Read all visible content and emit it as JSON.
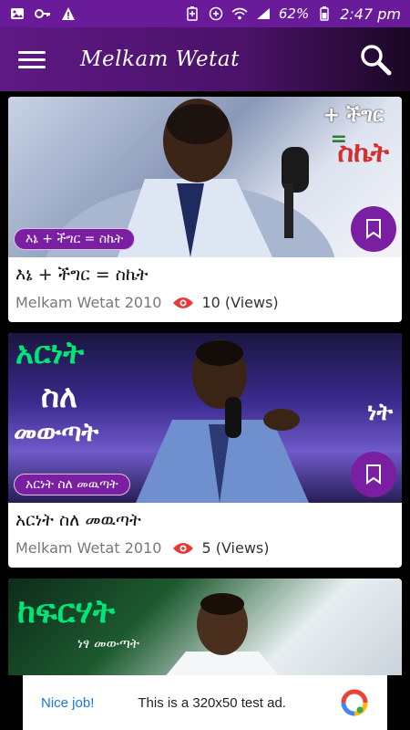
{
  "status_bar": {
    "battery": "62%",
    "time": "2:47 pm"
  },
  "app_bar": {
    "title": "Melkam Wetat"
  },
  "feed": {
    "items": [
      {
        "tag": "እኔ + ችግር = ስኬት",
        "title": "እኔ + ችግር = ስኬት",
        "channel": "Melkam Wetat 2010",
        "views": "10 (Views)",
        "overlay_lines": [
          "+ ችግር",
          "=",
          "ስኬት"
        ]
      },
      {
        "tag": "አርነት ስለ መዉጣት",
        "title": "አርነት ስለ መዉጣት",
        "channel": "Melkam Wetat 2010",
        "views": "5 (Views)",
        "overlay_lines": [
          "አርነት",
          "ስለ",
          "መውጣት",
          "ነት"
        ]
      },
      {
        "overlay_lines": [
          "ከፍርሃት",
          "ነፃ መውጣት"
        ]
      }
    ]
  },
  "ad": {
    "nice": "Nice job!",
    "text": "This is a 320x50 test ad."
  },
  "colors": {
    "primary": "#6a1b9a",
    "accent": "#7b1fa2",
    "views_eye": "#e53935"
  }
}
